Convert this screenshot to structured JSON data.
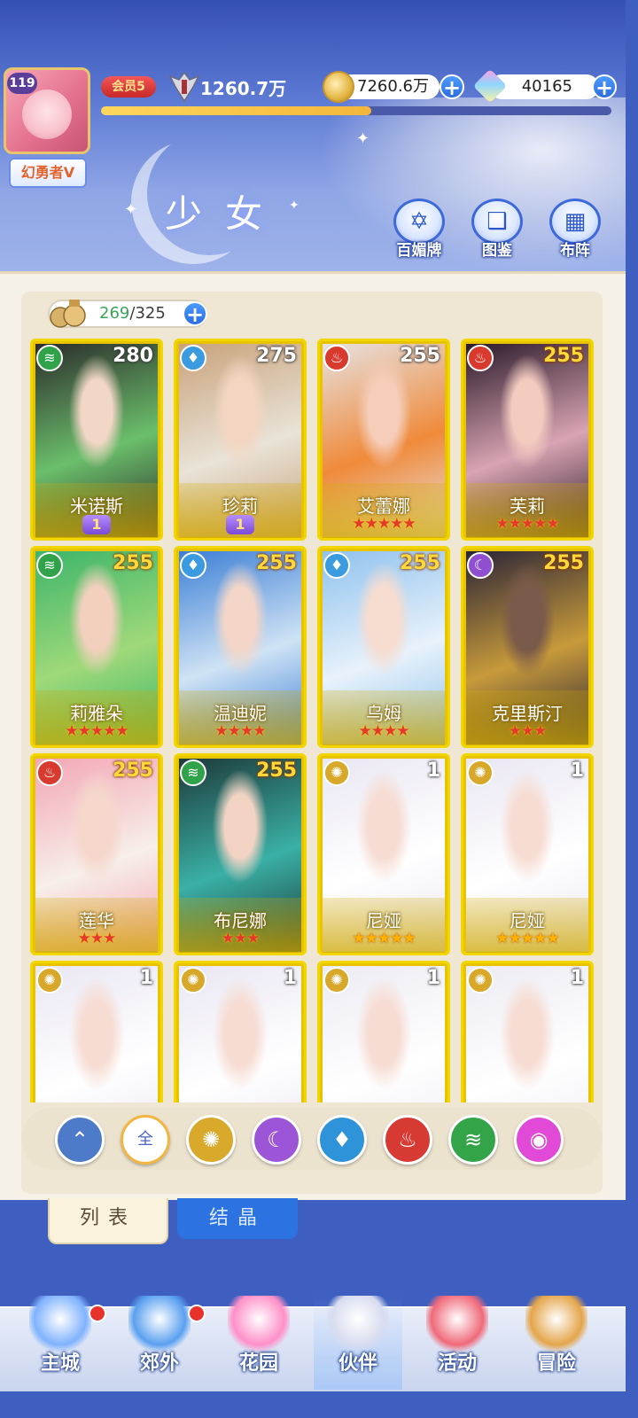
{
  "player": {
    "level": "119",
    "title": "幻勇者V",
    "vip_label": "会员5",
    "power": "1260.7万",
    "gold": "7260.6万",
    "gems": "40165",
    "xp_fraction": 0.53
  },
  "page": {
    "title": "少女",
    "quick_actions": [
      {
        "label": "百媚牌",
        "icon": "hexagram-icon"
      },
      {
        "label": "图鉴",
        "icon": "book-icon"
      },
      {
        "label": "布阵",
        "icon": "grid-icon"
      }
    ]
  },
  "roster": {
    "owned": "269",
    "total": "325",
    "separator": "/"
  },
  "cards": [
    {
      "name": "米诺斯",
      "level": "280",
      "element": "wind",
      "stars": 0,
      "badge": "1",
      "art": [
        "#2b2b2b",
        "#6bbf6b",
        "#f2d6c6"
      ]
    },
    {
      "name": "珍莉",
      "level": "275",
      "element": "water",
      "stars": 0,
      "badge": "1",
      "art": [
        "#c9a27a",
        "#e9e3d8",
        "#f3d6c2"
      ]
    },
    {
      "name": "艾蕾娜",
      "level": "255",
      "element": "fire",
      "stars": 5,
      "star_type": "red",
      "art": [
        "#e6e1e0",
        "#f08a3a",
        "#f5cdb9"
      ]
    },
    {
      "name": "芙莉",
      "level": "255",
      "element": "fire",
      "stars": 5,
      "star_type": "red",
      "level_gold": true,
      "art": [
        "#2a1a2a",
        "#d9a4b3",
        "#f3cbbf"
      ]
    },
    {
      "name": "莉雅朵",
      "level": "255",
      "element": "wind",
      "stars": 5,
      "star_type": "red",
      "level_gold": true,
      "art": [
        "#3cb56a",
        "#9fd97a",
        "#f2d0bd"
      ]
    },
    {
      "name": "温迪妮",
      "level": "255",
      "element": "water",
      "stars": 4,
      "star_type": "red",
      "level_gold": true,
      "art": [
        "#3c7fd6",
        "#cfe3f5",
        "#f3d6c8"
      ]
    },
    {
      "name": "乌姆",
      "level": "255",
      "element": "water",
      "stars": 4,
      "star_type": "red",
      "level_gold": true,
      "art": [
        "#8fc2ee",
        "#e8f2fb",
        "#f7dcd0"
      ]
    },
    {
      "name": "克里斯汀",
      "level": "255",
      "element": "moon",
      "stars": 3,
      "star_type": "red",
      "level_gold": true,
      "art": [
        "#2a2438",
        "#c79a3a",
        "#7a5a4a"
      ]
    },
    {
      "name": "莲华",
      "level": "255",
      "element": "fire",
      "stars": 3,
      "star_type": "red",
      "level_gold": true,
      "art": [
        "#f3a6b6",
        "#f7efe9",
        "#f5d7cc"
      ]
    },
    {
      "name": "布尼娜",
      "level": "255",
      "element": "wind",
      "stars": 3,
      "star_type": "red",
      "level_gold": true,
      "art": [
        "#1d3a3a",
        "#3ab0a6",
        "#f3d4c4"
      ]
    },
    {
      "name": "尼娅",
      "level": "1",
      "element": "light",
      "stars": 5,
      "star_type": "gold",
      "art": [
        "#e9e6f2",
        "#ffffff",
        "#f6dcd2"
      ]
    },
    {
      "name": "尼娅",
      "level": "1",
      "element": "light",
      "stars": 5,
      "star_type": "gold",
      "art": [
        "#e9e6f2",
        "#ffffff",
        "#f6dcd2"
      ]
    },
    {
      "name": "",
      "level": "1",
      "element": "light",
      "stars": 0,
      "art": [
        "#e9e6f2",
        "#ffffff",
        "#f6dcd2"
      ]
    },
    {
      "name": "",
      "level": "1",
      "element": "light",
      "stars": 0,
      "art": [
        "#e9e6f2",
        "#ffffff",
        "#f6dcd2"
      ]
    },
    {
      "name": "",
      "level": "1",
      "element": "light",
      "stars": 0,
      "art": [
        "#ecebf3",
        "#ffffff",
        "#f6dcd2"
      ]
    },
    {
      "name": "",
      "level": "1",
      "element": "light",
      "stars": 0,
      "art": [
        "#ecebf3",
        "#ffffff",
        "#f6dcd2"
      ]
    }
  ],
  "filters": [
    {
      "id": "wind-all",
      "label": "",
      "color": "#4d7bc9",
      "icon": "wing-icon"
    },
    {
      "id": "all",
      "label": "全",
      "color": "#ffffff",
      "icon": "all-icon"
    },
    {
      "id": "light",
      "label": "",
      "color": "#d9a92c",
      "icon": "sun-icon"
    },
    {
      "id": "moon",
      "label": "",
      "color": "#9c55d6",
      "icon": "crescent-icon"
    },
    {
      "id": "water",
      "label": "",
      "color": "#2f93d9",
      "icon": "water-drop-icon"
    },
    {
      "id": "fire",
      "label": "",
      "color": "#d63a33",
      "icon": "flame-icon"
    },
    {
      "id": "wind",
      "label": "",
      "color": "#33a548",
      "icon": "tornado-icon"
    },
    {
      "id": "charm",
      "label": "",
      "color": "#e04ad6",
      "icon": "orb-icon"
    }
  ],
  "tabs": {
    "list": "列表",
    "crystal": "结晶"
  },
  "bottom_nav": [
    {
      "label": "主城",
      "icon": "castle-icon",
      "dot": true,
      "color": "#7fb2ff"
    },
    {
      "label": "郊外",
      "icon": "portal-icon",
      "dot": true,
      "color": "#5aa0f0"
    },
    {
      "label": "花园",
      "icon": "heart-icon",
      "dot": false,
      "color": "#ff8fc8"
    },
    {
      "label": "伙伴",
      "icon": "partner-icon",
      "dot": false,
      "color": "#d8dcef"
    },
    {
      "label": "活动",
      "icon": "gift-icon",
      "dot": false,
      "color": "#f06a7a"
    },
    {
      "label": "冒险",
      "icon": "compass-icon",
      "dot": false,
      "color": "#e4a54a"
    }
  ],
  "element_colors": {
    "wind": "#2fa24a",
    "water": "#3b9be0",
    "fire": "#d93a2e",
    "moon": "#8f4fd0",
    "light": "#d7a82a"
  },
  "element_glyphs": {
    "wind": "≋",
    "water": "♦",
    "fire": "♨",
    "moon": "☾",
    "light": "✺"
  }
}
